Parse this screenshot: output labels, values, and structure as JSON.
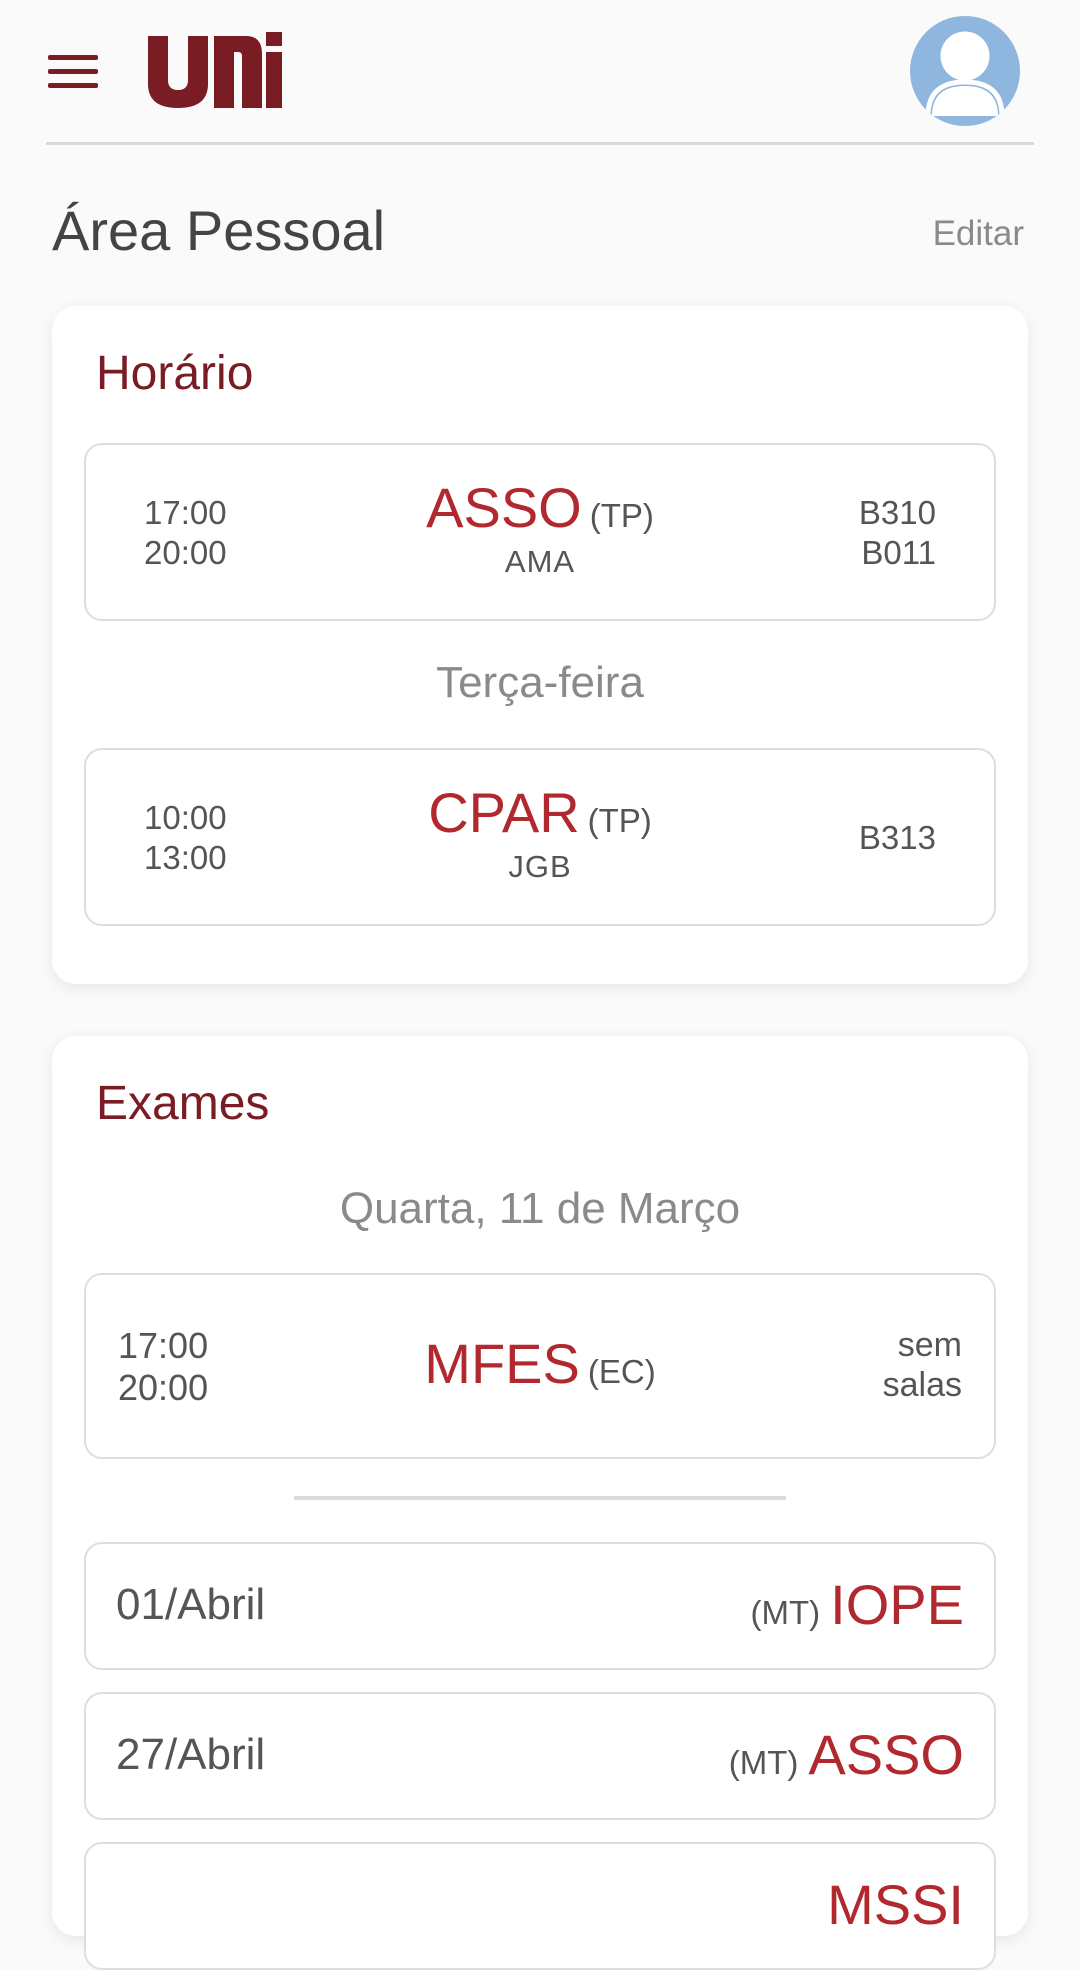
{
  "header": {
    "menu_icon": "hamburger-menu-icon",
    "logo_text": "uni",
    "avatar_icon": "user-avatar-icon",
    "brand_color": "#7a1c23",
    "avatar_color": "#8fb6de"
  },
  "page": {
    "title": "Área Pessoal",
    "edit_label": "Editar"
  },
  "schedule": {
    "title": "Horário",
    "entries": [
      {
        "start": "17:00",
        "end": "20:00",
        "subject": "ASSO",
        "type": "(TP)",
        "teacher": "AMA",
        "rooms": [
          "B310",
          "B011"
        ]
      },
      {
        "day_label": "Terça-feira",
        "start": "10:00",
        "end": "13:00",
        "subject": "CPAR",
        "type": "(TP)",
        "teacher": "JGB",
        "rooms": [
          "B313"
        ]
      }
    ]
  },
  "exams": {
    "title": "Exames",
    "featured_date": "Quarta, 11 de Março",
    "featured": {
      "start": "17:00",
      "end": "20:00",
      "subject": "MFES",
      "type": "(EC)",
      "room_line1": "sem",
      "room_line2": "salas"
    },
    "upcoming": [
      {
        "date": "01/Abril",
        "type": "(MT)",
        "subject": "IOPE"
      },
      {
        "date": "27/Abril",
        "type": "(MT)",
        "subject": "ASSO"
      },
      {
        "date": "",
        "type": "",
        "subject": "MSSI"
      }
    ],
    "accent_color": "#b1282e"
  }
}
